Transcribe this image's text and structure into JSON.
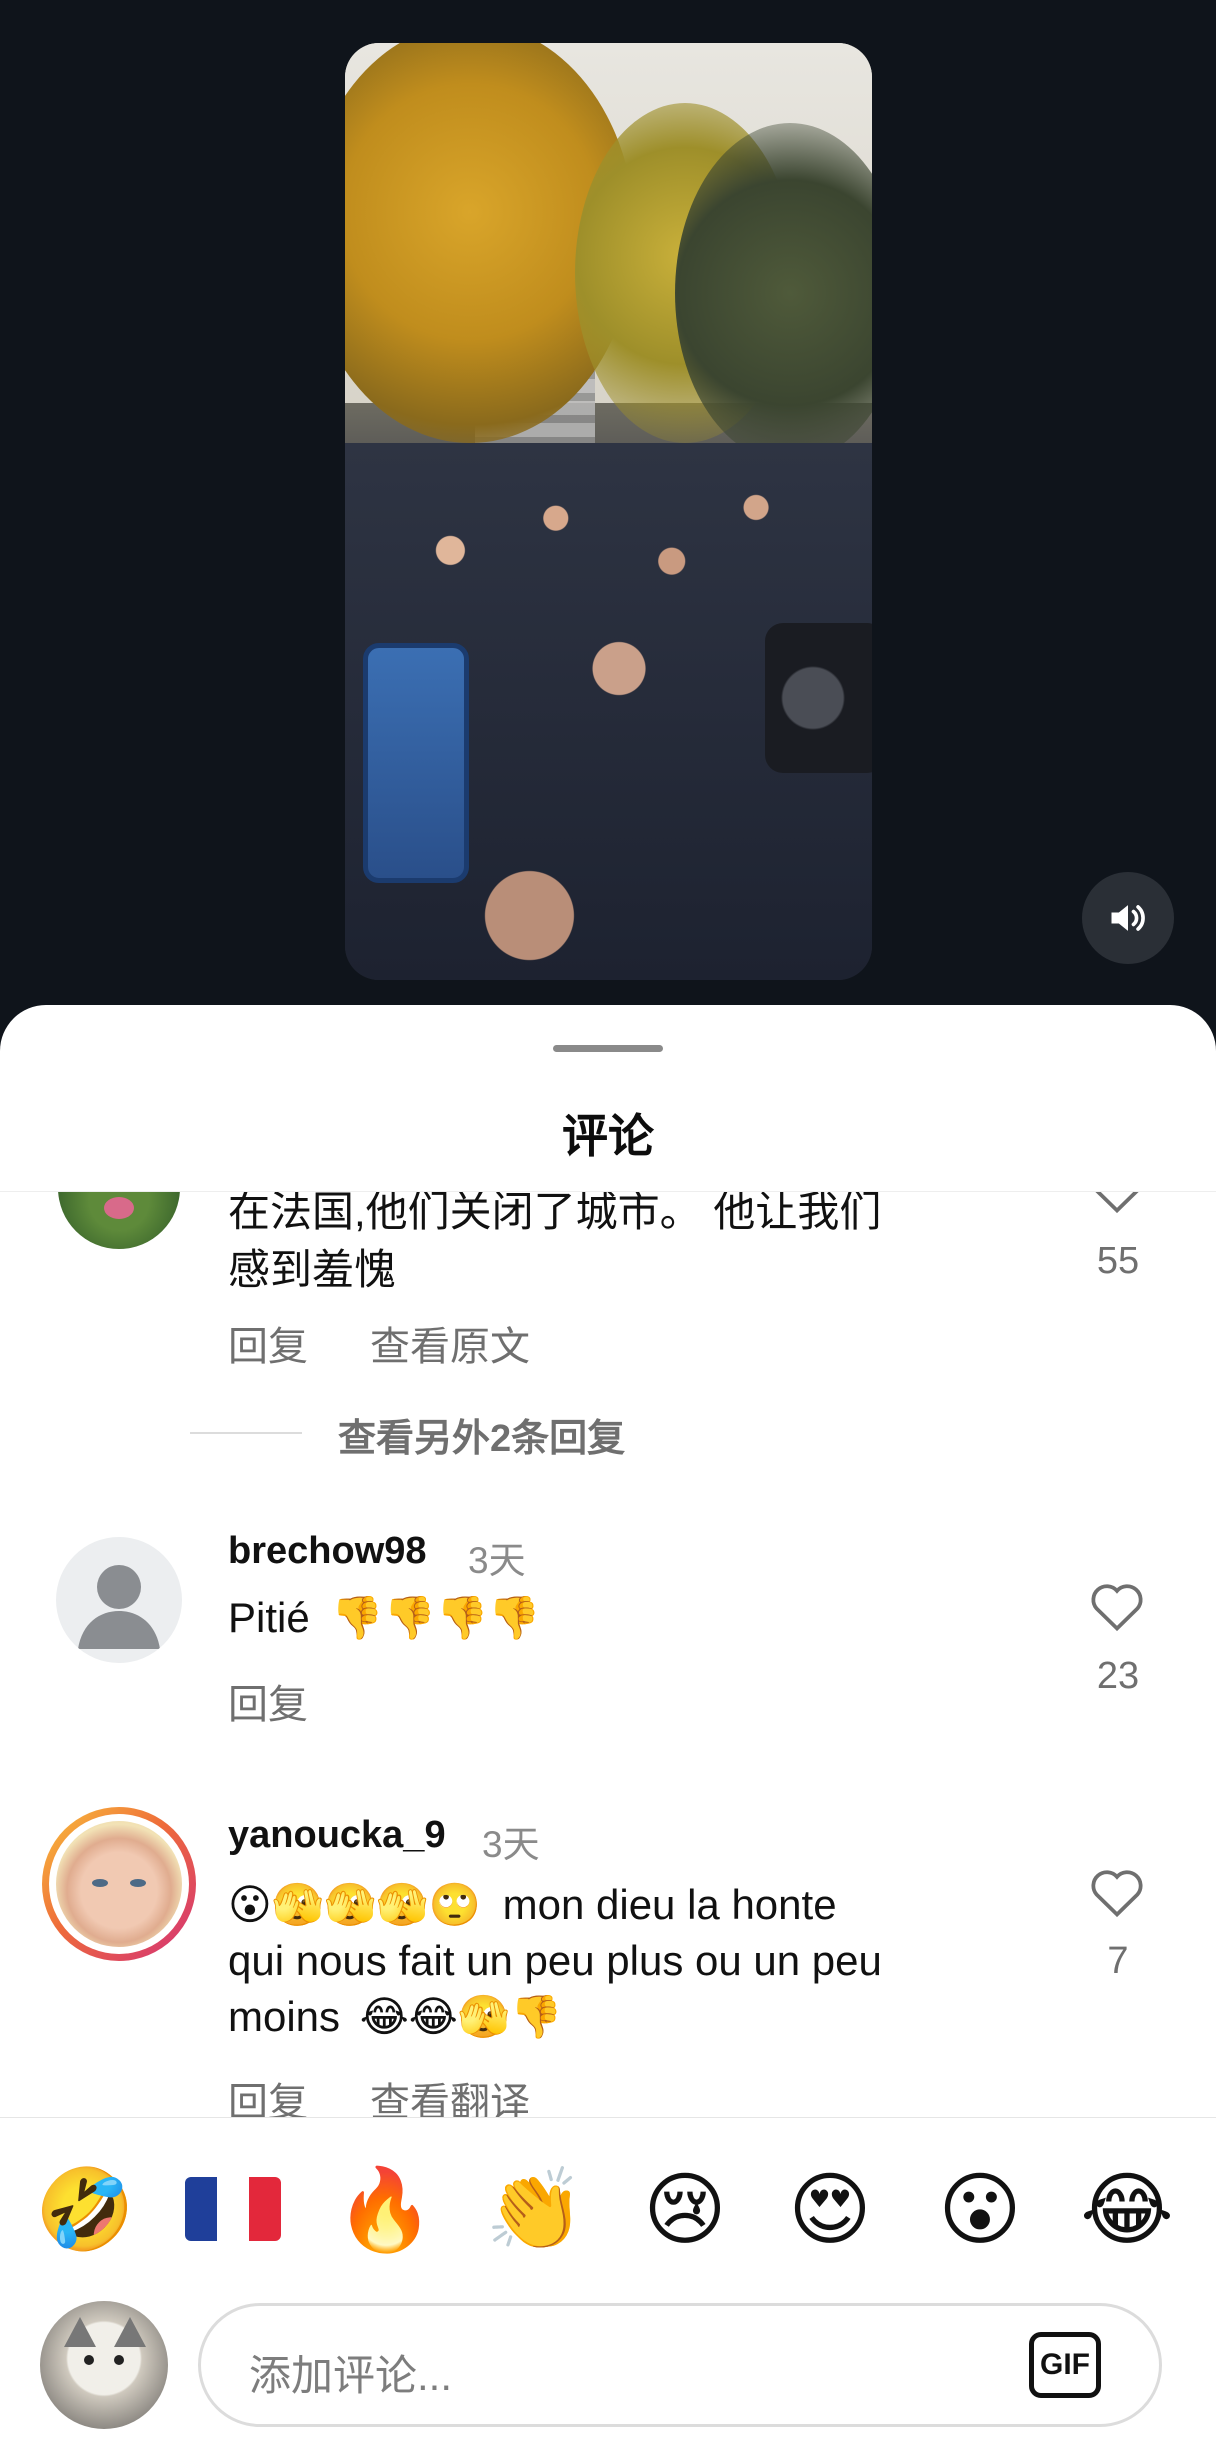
{
  "sheet": {
    "title": "评论"
  },
  "comments": [
    {
      "text_line1": "在法国,他们关闭了城市。 他让我们",
      "text_line2": "感到羞愧",
      "reply_label": "回复",
      "view_original_label": "查看原文",
      "likes": "55"
    },
    {
      "username": "brechow98",
      "time": "3天",
      "text": "Pitié",
      "emojis": "👎👎👎👎",
      "reply_label": "回复",
      "likes": "23"
    },
    {
      "username": "yanoucka_9",
      "time": "3天",
      "line1_emojis": "😮🫣🫣🫣🙄",
      "line1_text": "mon dieu la honte",
      "line2": "qui nous fait un peu plus ou un peu",
      "line3_text": "moins",
      "line3_emojis": "😂😂🫣👎",
      "reply_label": "回复",
      "view_translation_label": "查看翻译",
      "likes": "7"
    }
  ],
  "view_more_replies": "查看另外2条回复",
  "quick_emojis": [
    "🤣",
    "🔥",
    "👏",
    "😢",
    "😍",
    "😮",
    "😂"
  ],
  "composer": {
    "placeholder": "添加评论...",
    "gif_label": "GIF"
  },
  "icons": {
    "sound": "speaker-icon",
    "like": "heart-outline-icon",
    "flag": "france-flag-icon",
    "default_avatar": "user-silhouette-icon"
  },
  "colors": {
    "background": "#0f141b",
    "sheet": "#ffffff",
    "secondary_text": "#6f6f6f",
    "story_ring_start": "#f9c23c",
    "story_ring_end": "#d3307a"
  }
}
